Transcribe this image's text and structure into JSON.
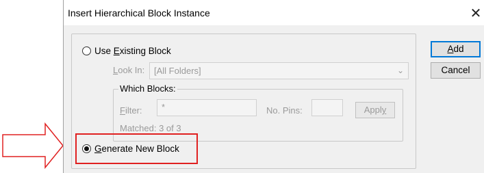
{
  "dialog": {
    "title": "Insert Hierarchical Block Instance",
    "close_glyph": "✕"
  },
  "options": {
    "use_existing": {
      "pre": "Use ",
      "accel": "E",
      "post": "xisting Block",
      "checked": false
    },
    "generate_new": {
      "pre": "",
      "accel": "G",
      "post": "enerate New Block",
      "checked": true
    }
  },
  "look_in": {
    "label_accel": "L",
    "label_rest": "ook In:",
    "value": "[All Folders]",
    "chevron_icon": "chevron-down-icon"
  },
  "which_blocks": {
    "label": "Which Blocks:",
    "filter_accel": "F",
    "filter_rest": "ilter:",
    "filter_value": "*",
    "pins_label": "No. Pins:",
    "pins_value": "",
    "apply_pre": "Appl",
    "apply_accel": "y",
    "matched": "Matched: 3 of 3"
  },
  "buttons": {
    "add_accel": "A",
    "add_rest": "dd",
    "cancel": "Cancel"
  },
  "annotation": {
    "highlight_color": "#e02020",
    "arrow_icon": "right-arrow-icon"
  }
}
